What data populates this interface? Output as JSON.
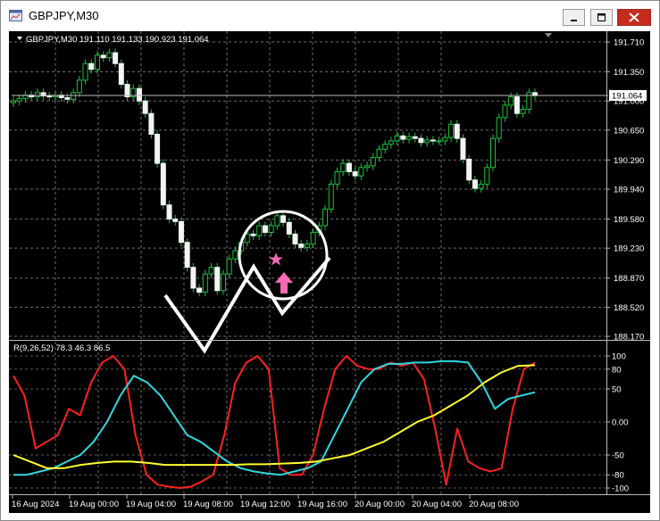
{
  "window": {
    "title": "GBPJPY,M30",
    "icons": [
      "chart-window-icon",
      "minimize-icon",
      "maximize-icon",
      "close-icon"
    ]
  },
  "chart_data": [
    {
      "type": "candlestick",
      "header": "GBPJPY,M30  191.110 191.133 190.923 191.064",
      "price_ticks": [
        "191.710",
        "191.350",
        "191.000",
        "190.650",
        "190.290",
        "189.940",
        "189.580",
        "189.230",
        "188.870",
        "188.520",
        "188.170"
      ],
      "current_price_label": "191.064",
      "current_price": 191.064,
      "ylim": [
        188.17,
        191.71
      ],
      "time_labels": [
        "16 Aug 2024",
        "19 Aug 00:00",
        "19 Aug 04:00",
        "19 Aug 08:00",
        "19 Aug 12:00",
        "19 Aug 16:00",
        "20 Aug 00:00",
        "20 Aug 04:00",
        "20 Aug 08:00"
      ],
      "closes": [
        191.0,
        191.03,
        191.07,
        191.05,
        191.1,
        191.06,
        191.05,
        191.07,
        191.04,
        191.02,
        191.1,
        191.25,
        191.45,
        191.38,
        191.55,
        191.52,
        191.58,
        191.45,
        191.2,
        191.05,
        191.15,
        191.0,
        190.85,
        190.6,
        190.25,
        189.75,
        189.58,
        189.55,
        189.3,
        189.0,
        188.75,
        188.7,
        188.92,
        189.0,
        188.72,
        188.92,
        189.1,
        189.2,
        189.3,
        189.4,
        189.38,
        189.5,
        189.42,
        189.5,
        189.62,
        189.54,
        189.4,
        189.28,
        189.24,
        189.28,
        189.42,
        189.5,
        189.7,
        190.0,
        190.15,
        190.25,
        190.15,
        190.1,
        190.2,
        190.22,
        190.32,
        190.42,
        190.48,
        190.52,
        190.58,
        190.54,
        190.57,
        190.55,
        190.5,
        190.53,
        190.52,
        190.52,
        190.56,
        190.72,
        190.55,
        190.3,
        190.05,
        189.95,
        190.0,
        190.2,
        190.55,
        190.8,
        190.95,
        191.05,
        190.85,
        190.9,
        191.1,
        191.064
      ],
      "indicator": {
        "label": "R(9,26,52) 78.3 46.3 86.5",
        "ticks": [
          "100",
          "80",
          "50",
          "0.00",
          "-50",
          "-80",
          "-100"
        ],
        "ylim": [
          -100,
          100
        ],
        "series": [
          {
            "color": "#ff2020",
            "values": [
              70,
              40,
              -40,
              -30,
              -20,
              20,
              10,
              60,
              90,
              100,
              80,
              -20,
              -80,
              -95,
              -98,
              -100,
              -98,
              -90,
              -80,
              -20,
              60,
              90,
              100,
              80,
              -70,
              -80,
              -80,
              -50,
              20,
              80,
              100,
              85,
              80,
              80,
              90,
              85,
              90,
              65,
              -10,
              -95,
              -10,
              -60,
              -70,
              -75,
              -70,
              20,
              80,
              90
            ]
          },
          {
            "color": "#30d8e0",
            "values": [
              -80,
              -80,
              -75,
              -70,
              -60,
              -50,
              -30,
              0,
              40,
              70,
              60,
              40,
              10,
              -20,
              -30,
              -45,
              -60,
              -70,
              -75,
              -78,
              -80,
              -75,
              -70,
              -60,
              -20,
              20,
              60,
              80,
              88,
              88,
              90,
              90,
              92,
              92,
              90,
              60,
              20,
              35,
              40,
              45
            ]
          },
          {
            "color": "#ffff30",
            "values": [
              -50,
              -60,
              -70,
              -70,
              -65,
              -62,
              -60,
              -60,
              -62,
              -65,
              -65,
              -65,
              -65,
              -65,
              -64,
              -64,
              -63,
              -62,
              -60,
              -55,
              -50,
              -40,
              -30,
              -15,
              0,
              10,
              25,
              40,
              60,
              75,
              85,
              86
            ]
          }
        ]
      }
    }
  ]
}
